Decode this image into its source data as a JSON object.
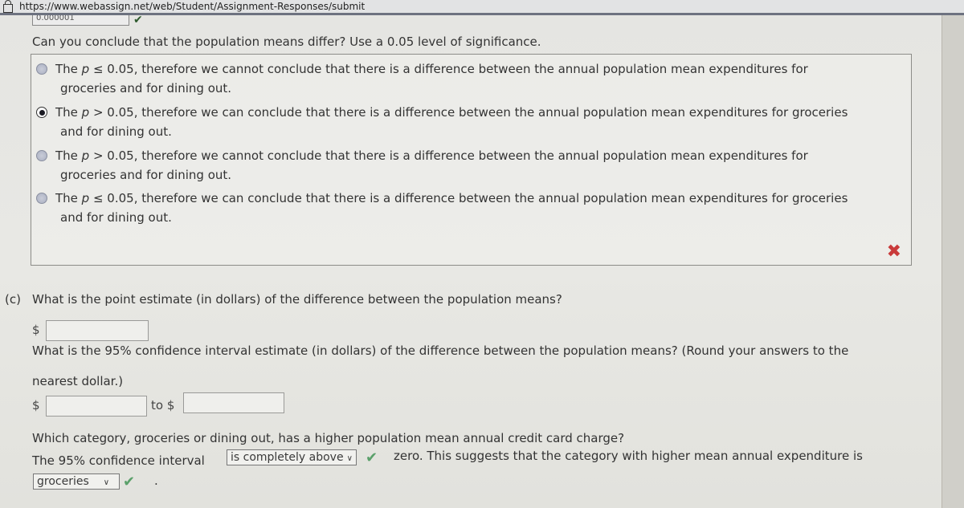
{
  "browser": {
    "url": "https://www.webassign.net/web/Student/Assignment-Responses/submit"
  },
  "previous": {
    "answer_value": "0.000001"
  },
  "part_b": {
    "question": "Can you conclude that the population means differ? Use a 0.05 level of significance.",
    "options": [
      {
        "prefix": "The ",
        "p": "p",
        "line1": " ≤ 0.05, therefore we cannot conclude that there is a difference between the annual population mean expenditures for",
        "line2": "groceries and for dining out.",
        "selected": false
      },
      {
        "prefix": "The ",
        "p": "p",
        "line1": " > 0.05, therefore we can conclude that there is a difference between the annual population mean expenditures for groceries",
        "line2": "and for dining out.",
        "selected": true
      },
      {
        "prefix": "The ",
        "p": "p",
        "line1": " > 0.05, therefore we cannot conclude that there is a difference between the annual population mean expenditures for",
        "line2": "groceries and for dining out.",
        "selected": false
      },
      {
        "prefix": "The ",
        "p": "p",
        "line1": " ≤ 0.05, therefore we can conclude that there is a difference between the annual population mean expenditures for groceries",
        "line2": "and for dining out.",
        "selected": false
      }
    ],
    "result": "incorrect"
  },
  "part_c": {
    "label": "(c)",
    "point_estimate_question": "What is the point estimate (in dollars) of the difference between the population means?",
    "point_estimate_currency": "$",
    "point_estimate_value": "",
    "ci_question_line1": "What is the 95% confidence interval estimate (in dollars) of the difference between the population means? (Round your answers to the",
    "ci_question_line2": "nearest dollar.)",
    "ci_lower_currency": "$",
    "ci_lower_value": "",
    "ci_to_label": "to $",
    "ci_upper_value": "",
    "category_question": "Which category, groceries or dining out, has a higher population mean annual credit card charge?",
    "ci_sentence_prefix": "The 95% confidence interval",
    "ci_position_select": "is completely above",
    "ci_sentence_suffix": "zero. This suggests that the category with higher mean annual expenditure is",
    "category_select": "groceries",
    "sentence_end": "."
  }
}
